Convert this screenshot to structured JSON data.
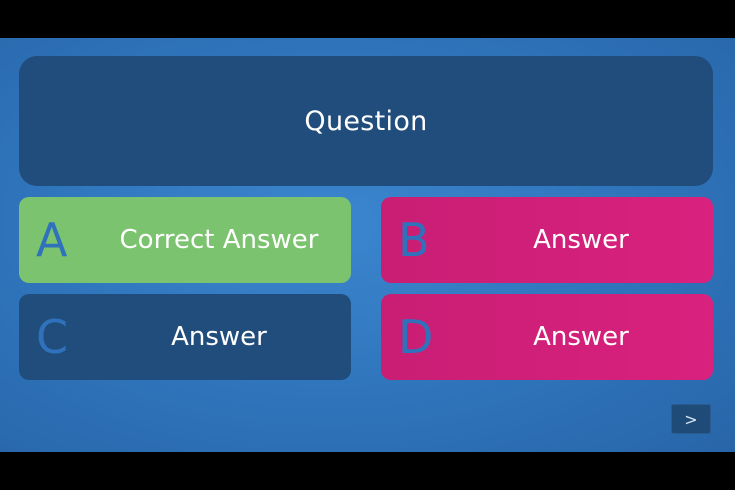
{
  "question": {
    "text": "Question"
  },
  "answers": [
    {
      "letter": "A",
      "text": "Correct Answer",
      "color": "#7bc36e"
    },
    {
      "letter": "B",
      "text": "Answer",
      "color": "#d11f79"
    },
    {
      "letter": "C",
      "text": "Answer",
      "color": "#204d7c"
    },
    {
      "letter": "D",
      "text": "Answer",
      "color": "#d11f79"
    }
  ],
  "navigation": {
    "next_label": ">"
  },
  "theme": {
    "background": "#3179c0",
    "question_box": "#204d7c",
    "letter_color": "#2f72bb"
  }
}
